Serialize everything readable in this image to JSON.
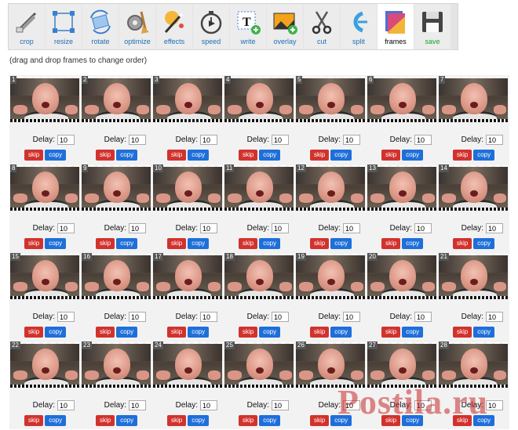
{
  "toolbar": {
    "tools": [
      {
        "id": "crop",
        "label": "crop",
        "icon": "crop-icon"
      },
      {
        "id": "resize",
        "label": "resize",
        "icon": "resize-icon"
      },
      {
        "id": "rotate",
        "label": "rotate",
        "icon": "rotate-icon"
      },
      {
        "id": "optimize",
        "label": "optimize",
        "icon": "gear-broom-icon"
      },
      {
        "id": "effects",
        "label": "effects",
        "icon": "magic-wand-icon"
      },
      {
        "id": "speed",
        "label": "speed",
        "icon": "stopwatch-icon"
      },
      {
        "id": "write",
        "label": "write",
        "icon": "text-icon"
      },
      {
        "id": "overlay",
        "label": "overlay",
        "icon": "image-overlay-icon"
      },
      {
        "id": "cut",
        "label": "cut",
        "icon": "scissors-icon"
      },
      {
        "id": "split",
        "label": "split",
        "icon": "split-icon"
      },
      {
        "id": "frames",
        "label": "frames",
        "icon": "frames-icon",
        "active": true
      },
      {
        "id": "save",
        "label": "save",
        "icon": "floppy-disk-icon"
      }
    ]
  },
  "hint": "(drag and drop frames to change order)",
  "frame_labels": {
    "delay": "Delay:",
    "delay_value": "10",
    "skip": "skip",
    "copy": "copy"
  },
  "frame_count": 28,
  "columns": 7,
  "colors": {
    "skip": "#d2322d",
    "copy": "#1e6fd9",
    "link": "#1f6fb8",
    "save": "#18a030"
  },
  "watermark": "Postila.ru"
}
